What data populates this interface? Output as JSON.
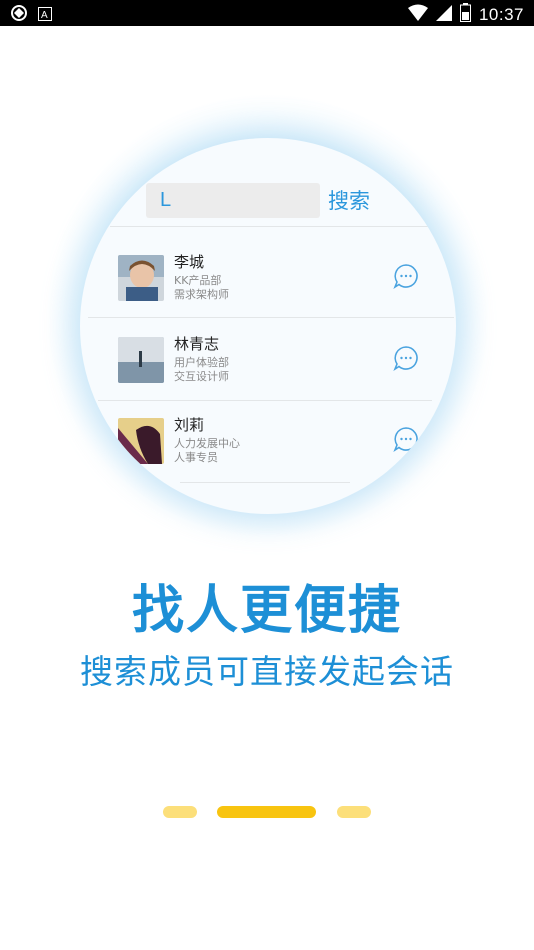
{
  "status_bar": {
    "time": "10:37",
    "left_icons": [
      "sync-icon",
      "font-icon"
    ],
    "right_icons": [
      "wifi-icon",
      "signal-icon",
      "battery-icon"
    ]
  },
  "search": {
    "value": "L",
    "button_label": "搜索"
  },
  "contacts": [
    {
      "name": "李城",
      "dept": "KK产品部",
      "title": "需求架构师"
    },
    {
      "name": "林青志",
      "dept": "用户体验部",
      "title": "交互设计师"
    },
    {
      "name": "刘莉",
      "dept": "人力发展中心",
      "title": "人事专员"
    }
  ],
  "headline": "找人更便捷",
  "subline": "搜索成员可直接发起会话",
  "pager": {
    "pages": 3,
    "active_index": 1
  },
  "colors": {
    "accent": "#1d8fd6",
    "indicator_active": "#f8c410",
    "indicator_inactive": "#fcdf7a"
  }
}
